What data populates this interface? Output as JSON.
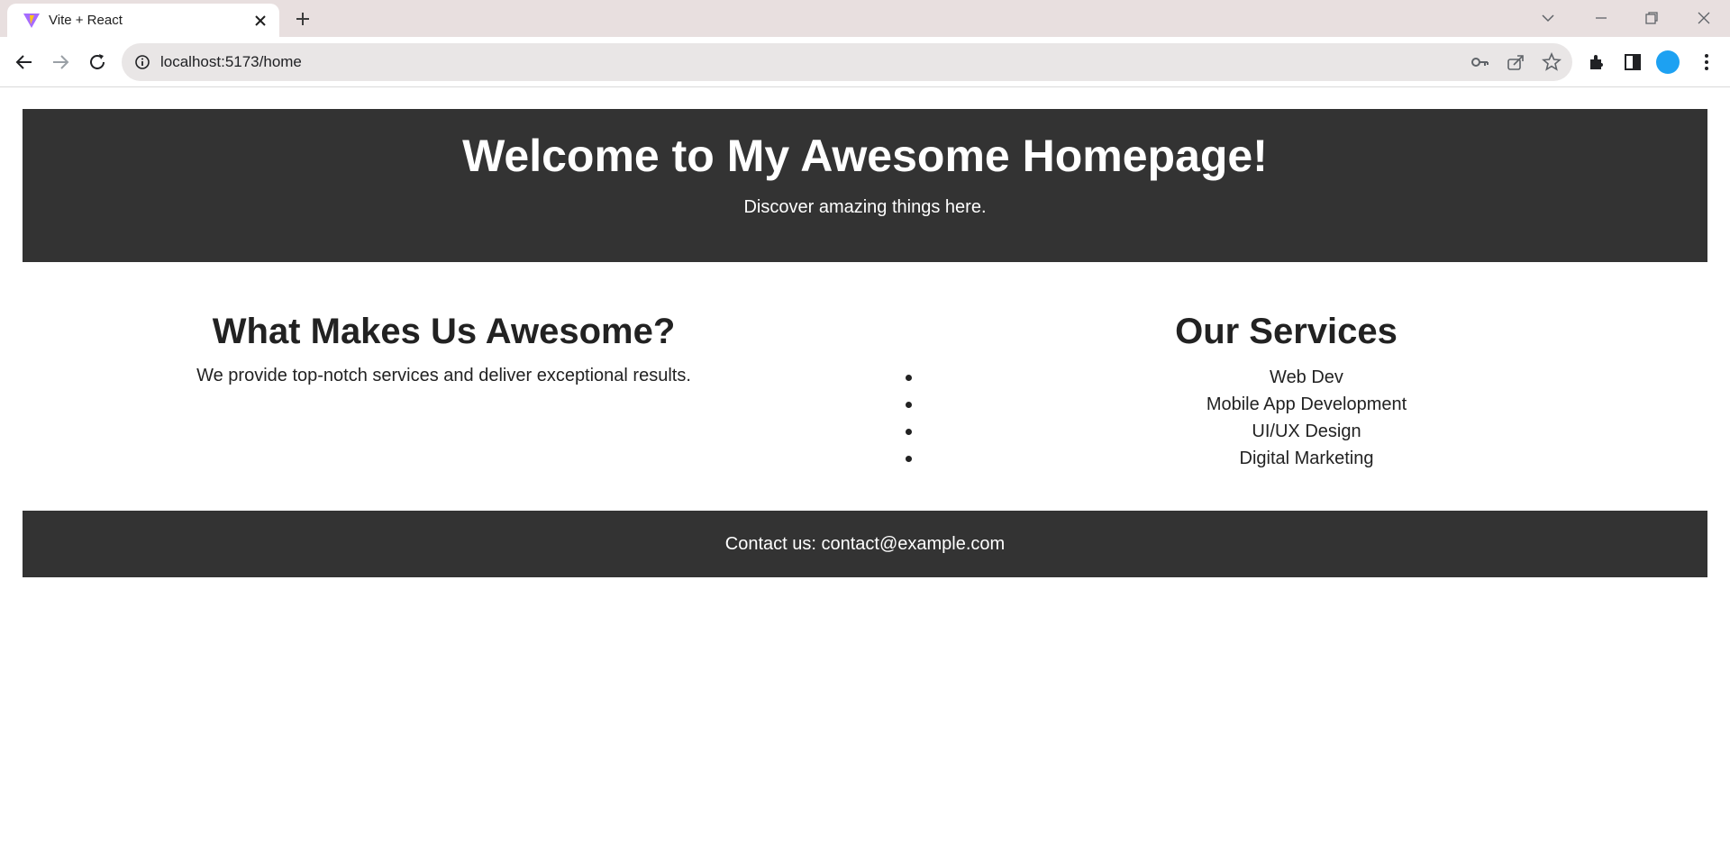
{
  "browser": {
    "tab": {
      "title": "Vite + React",
      "favicon": "vite-logo-icon"
    },
    "address_bar": {
      "url": "localhost:5173/home"
    }
  },
  "page": {
    "hero": {
      "title": "Welcome to My Awesome Homepage!",
      "subtitle": "Discover amazing things here."
    },
    "about": {
      "heading": "What Makes Us Awesome?",
      "text": "We provide top-notch services and deliver exceptional results."
    },
    "services": {
      "heading": "Our Services",
      "items": [
        "Web Dev",
        "Mobile App Development",
        "UI/UX Design",
        "Digital Marketing"
      ]
    },
    "footer": {
      "contact": "Contact us: contact@example.com"
    }
  },
  "colors": {
    "banner_bg": "#333333",
    "banner_text": "#ffffff",
    "body_text": "#222222",
    "avatar": "#1da1f2"
  }
}
